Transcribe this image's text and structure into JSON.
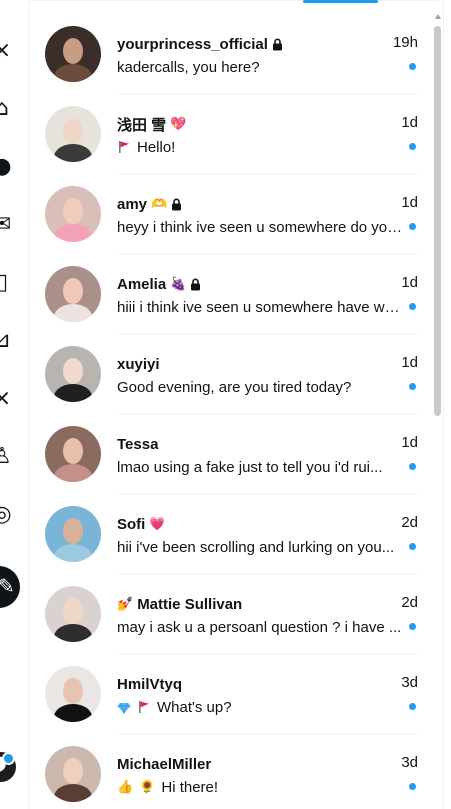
{
  "conversations": [
    {
      "name": "yourprincess_official",
      "badges": [
        "lock-icon"
      ],
      "time": "19h",
      "prefix_icons": [],
      "preview": "kadercalls, you here?",
      "unread": true,
      "avatar_colors": {
        "bg": "#3b2e2a",
        "face": "#c99c84",
        "body": "#6b4d3e"
      }
    },
    {
      "name": "浅田 雪",
      "badges": [
        "sparkling-heart-emoji"
      ],
      "badge_glyphs": [
        "💖"
      ],
      "time": "1d",
      "prefix_icons": [
        "red-flag-icon"
      ],
      "preview": "Hello!",
      "unread": true,
      "avatar_colors": {
        "bg": "#e8e2dc",
        "face": "#f0d6c6",
        "body": "#3a3a3a"
      }
    },
    {
      "name": "amy",
      "badges": [
        "heart-hands-emoji",
        "lock-icon"
      ],
      "badge_glyphs": [
        "🫶"
      ],
      "time": "1d",
      "prefix_icons": [],
      "preview": "heyy i think ive seen u somewhere do you ...",
      "unread": true,
      "avatar_colors": {
        "bg": "#d8c0b8",
        "face": "#f1cdbd",
        "body": "#f3a2b8"
      }
    },
    {
      "name": "Amelia",
      "badges": [
        "grape-emoji",
        "lock-icon"
      ],
      "badge_glyphs": [
        "🍇"
      ],
      "time": "1d",
      "prefix_icons": [],
      "preview": "hiii i think ive seen u somewhere have we...",
      "unread": true,
      "avatar_colors": {
        "bg": "#a9918a",
        "face": "#f0c8b5",
        "body": "#ece2e0"
      }
    },
    {
      "name": "xuyiyi",
      "badges": [],
      "time": "1d",
      "prefix_icons": [],
      "preview": "Good evening, are you tired today?",
      "unread": true,
      "avatar_colors": {
        "bg": "#b9b4b0",
        "face": "#f1d9cc",
        "body": "#202022"
      }
    },
    {
      "name": "Tessa",
      "badges": [],
      "time": "1d",
      "prefix_icons": [],
      "preview": "lmao using a fake just to tell you i'd rui...",
      "unread": true,
      "avatar_colors": {
        "bg": "#8b6a5f",
        "face": "#e8bfaa",
        "body": "#c4908a"
      }
    },
    {
      "name": "Sofi",
      "badges": [
        "heart-emoji"
      ],
      "badge_glyphs": [
        "💗"
      ],
      "time": "2d",
      "prefix_icons": [],
      "preview": "hii i've been scrolling and lurking on you...",
      "unread": true,
      "avatar_colors": {
        "bg": "#7ab4d6",
        "face": "#d9b19b",
        "body": "#9bc9e0"
      }
    },
    {
      "name": "Mattie Sullivan",
      "name_prefix_glyph": "💅",
      "badges": [],
      "time": "2d",
      "prefix_icons": [],
      "preview": "may i ask u a persoanl question ? i have ...",
      "unread": true,
      "avatar_colors": {
        "bg": "#d9d2ce",
        "face": "#f0d8c8",
        "body": "#2e2e30"
      }
    },
    {
      "name": "HmilVtyq",
      "badges": [],
      "time": "3d",
      "prefix_icons": [
        "gem-icon",
        "red-flag-icon"
      ],
      "preview": "What's up?",
      "unread": true,
      "avatar_colors": {
        "bg": "#e9e6e4",
        "face": "#e6c4b0",
        "body": "#111111"
      }
    },
    {
      "name": "MichaelMiller",
      "badges": [],
      "time": "3d",
      "prefix_icons": [
        "thumbs-up-icon",
        "sunflower-icon"
      ],
      "prefix_glyphs": [
        "👍",
        "🌻"
      ],
      "preview": "Hi there!",
      "unread": true,
      "avatar_colors": {
        "bg": "#cbb9ae",
        "face": "#efd0bd",
        "body": "#5a3d33"
      }
    }
  ],
  "colors": {
    "accent": "#1d9bf0",
    "text": "#0f1419",
    "divider": "#eff3f4",
    "flag_red": "#e0245e"
  }
}
